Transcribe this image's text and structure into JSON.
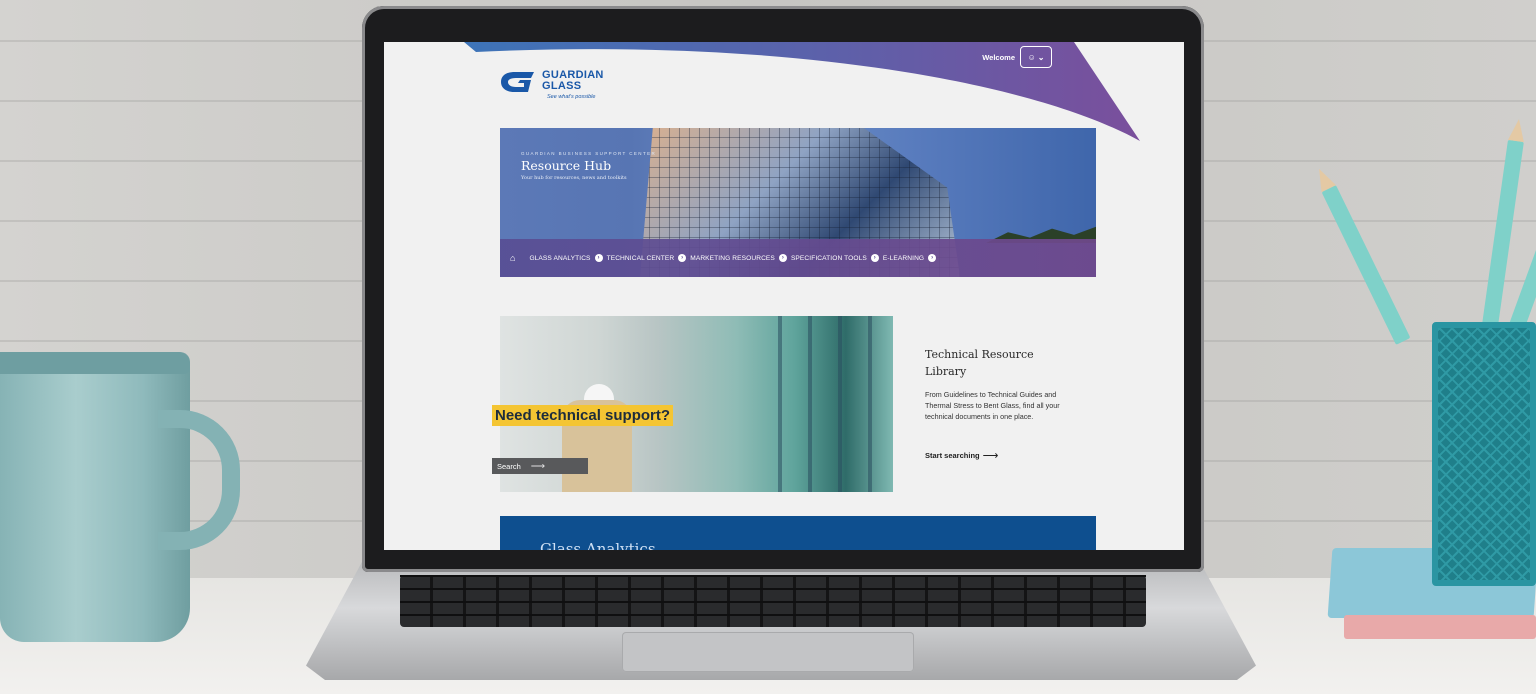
{
  "header": {
    "welcome_label": "Welcome",
    "logo_name_line1": "GUARDIAN",
    "logo_name_line2": "GLASS",
    "logo_tagline": "See what's possible",
    "brand_color": "#1a58a8",
    "swoosh_color": "#6b4fa0"
  },
  "hero": {
    "eyebrow": "GUARDIAN BUSINESS SUPPORT CENTER",
    "title": "Resource Hub",
    "subtitle": "Your hub for resources, news and toolkits"
  },
  "nav": {
    "home_icon": "home-icon",
    "items": [
      {
        "label": "GLASS ANALYTICS"
      },
      {
        "label": "TECHNICAL CENTER"
      },
      {
        "label": "MARKETING RESOURCES"
      },
      {
        "label": "SPECIFICATION TOOLS"
      },
      {
        "label": "E-LEARNING"
      }
    ]
  },
  "support": {
    "heading": "Need technical support?",
    "search_label": "Search",
    "heading_bg": "#f4c533"
  },
  "library": {
    "title": "Technical Resource Library",
    "description": "From Guidelines to Technical Guides and Thermal Stress to Bent Glass, find all your technical documents in one place.",
    "link_label": "Start searching"
  },
  "analytics": {
    "title": "Glass Analytics",
    "band_color": "#0e4f8f"
  }
}
